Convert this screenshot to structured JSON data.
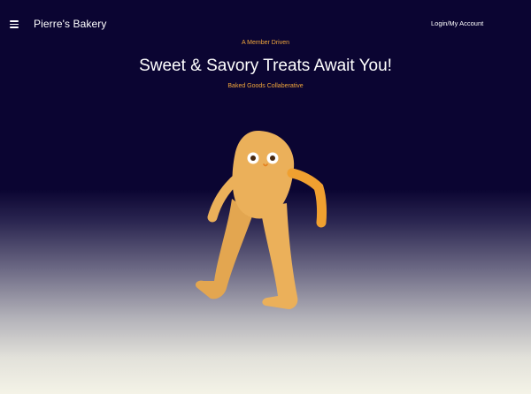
{
  "header": {
    "brand": "Pierre's Bakery",
    "login_label": "Login/My Account",
    "menu_icon": "hamburger-menu-icon"
  },
  "hero": {
    "eyebrow": "A Member Driven",
    "title": "Sweet & Savory Treats Await You!",
    "subtitle": "Baked Goods Collaberative"
  },
  "colors": {
    "background_top": "#0b0532",
    "background_bottom": "#f4f3e7",
    "accent": "#f2a73b",
    "mascot_body": "#ebb05a",
    "mascot_arm": "#f0a030",
    "text_light": "#ffffff"
  }
}
